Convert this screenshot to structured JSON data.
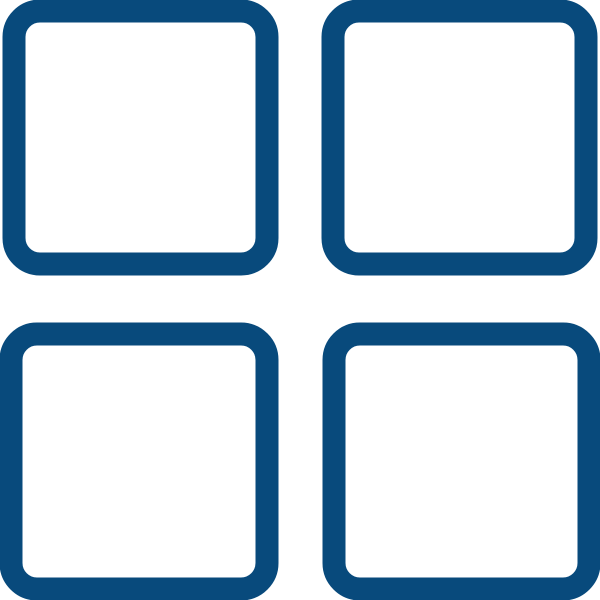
{
  "icon": {
    "name": "grid-view-icon",
    "stroke_color": "#084a7c",
    "background_color": "#ffffff"
  }
}
